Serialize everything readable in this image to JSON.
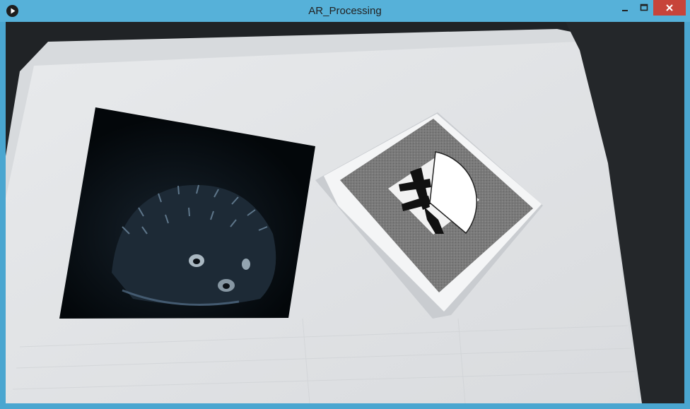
{
  "window": {
    "title": "AR_Processing"
  },
  "icons": {
    "app": "processing-play-icon",
    "minimize": "minimize-icon",
    "maximize": "maximize-icon",
    "close": "close-icon"
  },
  "colors": {
    "titlebar": "#56b1d9",
    "close_button": "#c7443a",
    "paper": "#e2e4e6",
    "marker_border": "#767676",
    "wedge": "#ffffff"
  }
}
